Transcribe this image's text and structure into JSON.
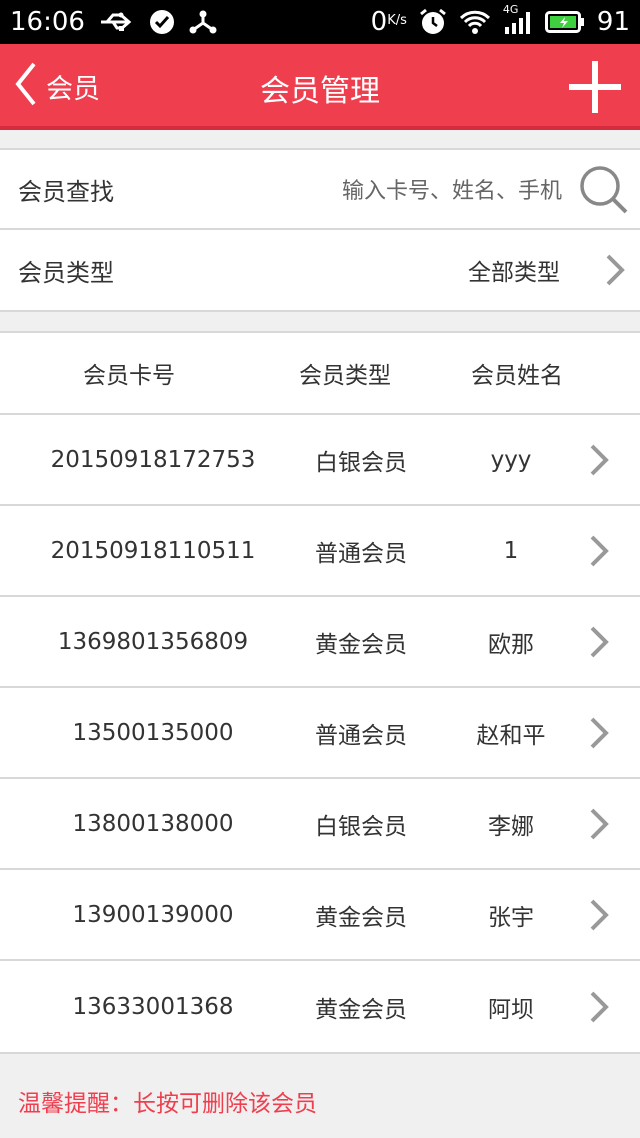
{
  "status_bar": {
    "time": "16:06",
    "net_speed": "0",
    "net_unit": "K/s",
    "signal_type": "4G",
    "battery": "91",
    "icons": [
      "usb-icon",
      "check-icon",
      "share-icon",
      "alarm-icon",
      "wifi-icon",
      "signal-icon",
      "battery-icon"
    ]
  },
  "header": {
    "back_label": "会员",
    "title": "会员管理",
    "add_icon": "plus-icon",
    "color": "#ef3e4e"
  },
  "search": {
    "label": "会员查找",
    "placeholder": "输入卡号、姓名、手机",
    "value": ""
  },
  "type_filter": {
    "label": "会员类型",
    "value": "全部类型"
  },
  "table": {
    "headers": [
      "会员卡号",
      "会员类型",
      "会员姓名"
    ],
    "rows": [
      {
        "card": "20150918172753",
        "type": "白银会员",
        "name": "yyy"
      },
      {
        "card": "20150918110511",
        "type": "普通会员",
        "name": "1"
      },
      {
        "card": "1369801356809",
        "type": "黄金会员",
        "name": "欧那"
      },
      {
        "card": "13500135000",
        "type": "普通会员",
        "name": "赵和平"
      },
      {
        "card": "13800138000",
        "type": "白银会员",
        "name": "李娜"
      },
      {
        "card": "13900139000",
        "type": "黄金会员",
        "name": "张宇"
      },
      {
        "card": "13633001368",
        "type": "黄金会员",
        "name": "阿坝"
      }
    ]
  },
  "footer_note": "温馨提醒：长按可删除该会员"
}
